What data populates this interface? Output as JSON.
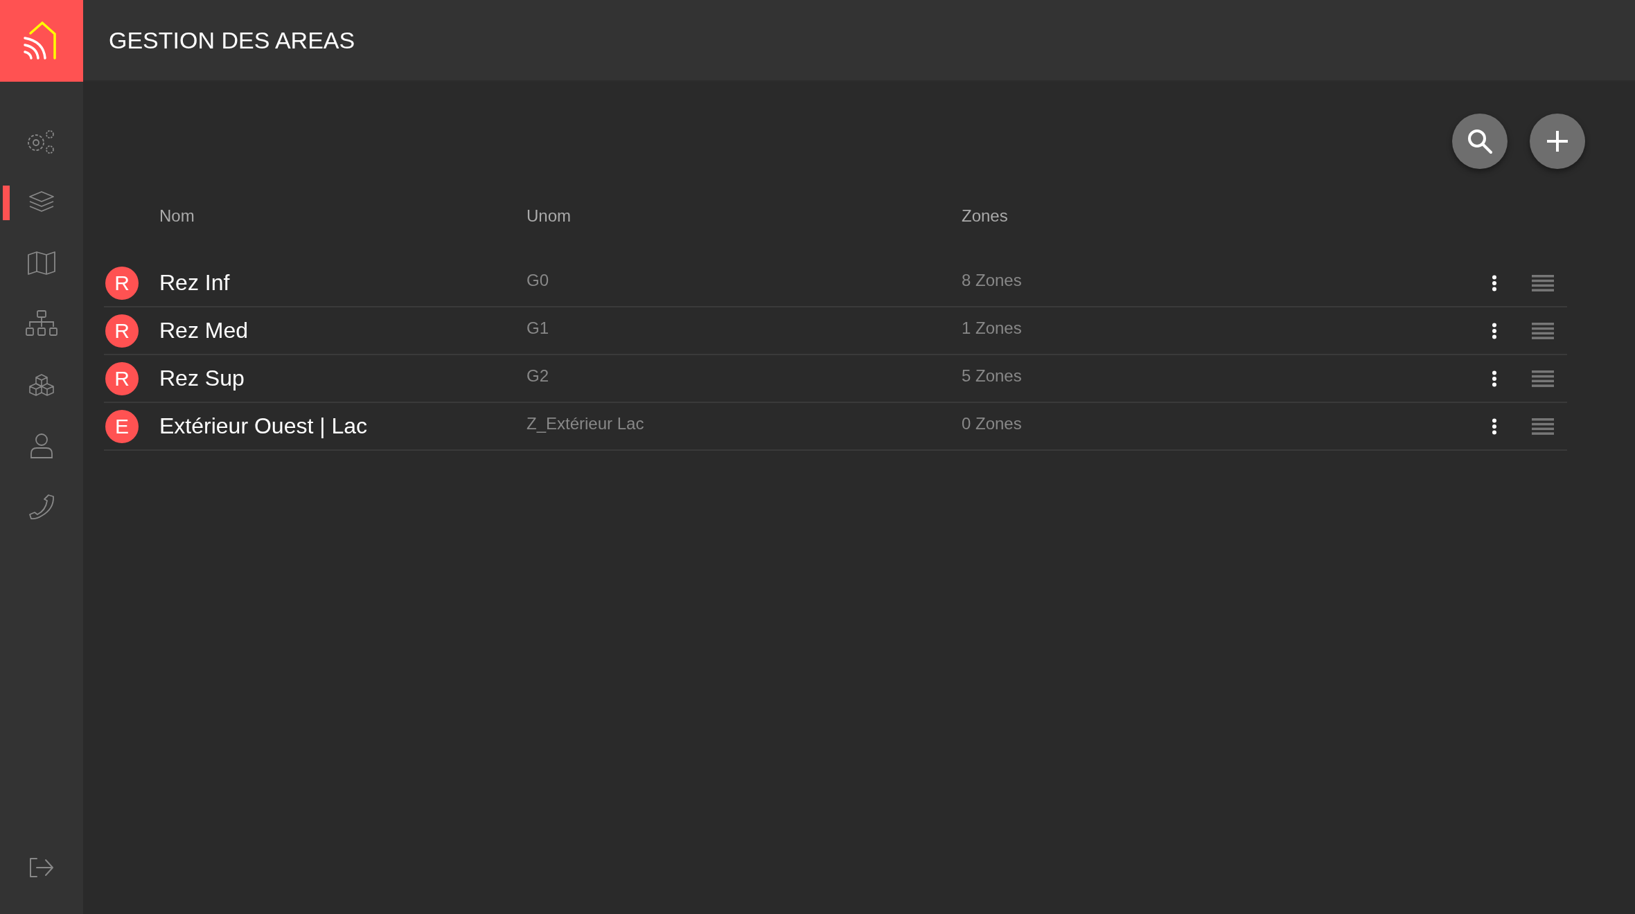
{
  "header": {
    "title": "GESTION DES AREAS"
  },
  "sidebar": {
    "items": [
      {
        "kind": "settings",
        "selected": false
      },
      {
        "kind": "layers",
        "selected": true
      },
      {
        "kind": "map",
        "selected": false
      },
      {
        "kind": "hierarchy",
        "selected": false
      },
      {
        "kind": "cubes",
        "selected": false
      },
      {
        "kind": "user",
        "selected": false
      },
      {
        "kind": "phone",
        "selected": false
      }
    ]
  },
  "table": {
    "columns": [
      "Nom",
      "Unom",
      "Zones"
    ],
    "rows": [
      {
        "initial": "R",
        "nom": "Rez Inf",
        "unom": "G0",
        "zones": "8 Zones"
      },
      {
        "initial": "R",
        "nom": "Rez Med",
        "unom": "G1",
        "zones": "1 Zones"
      },
      {
        "initial": "R",
        "nom": "Rez Sup",
        "unom": "G2",
        "zones": "5 Zones"
      },
      {
        "initial": "E",
        "nom": "Extérieur Ouest | Lac",
        "unom": "Z_Extérieur Lac",
        "zones": "0 Zones"
      }
    ]
  }
}
